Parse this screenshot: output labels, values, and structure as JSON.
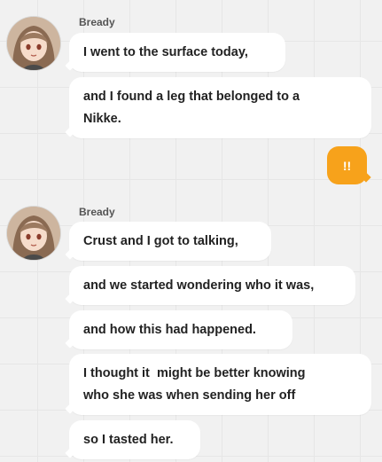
{
  "groups": [
    {
      "sender": "Bready",
      "avatar_icon": "character-portrait-icon",
      "messages": [
        "I went to the surface today,",
        "and I found a leg that belonged to a\nNikke."
      ]
    },
    {
      "sender": "Bready",
      "avatar_icon": "character-portrait-icon",
      "messages": [
        "Crust and I got to talking,",
        "and we started wondering who it was,",
        "and how this had happened.",
        "I thought it  might be better knowing\nwho she was when sending her off",
        "so I tasted her."
      ]
    }
  ],
  "my_reply": "!!",
  "colors": {
    "background": "#f1f1f1",
    "bubble": "#ffffff",
    "my_bubble": "#f7a21b",
    "text": "#222222"
  }
}
